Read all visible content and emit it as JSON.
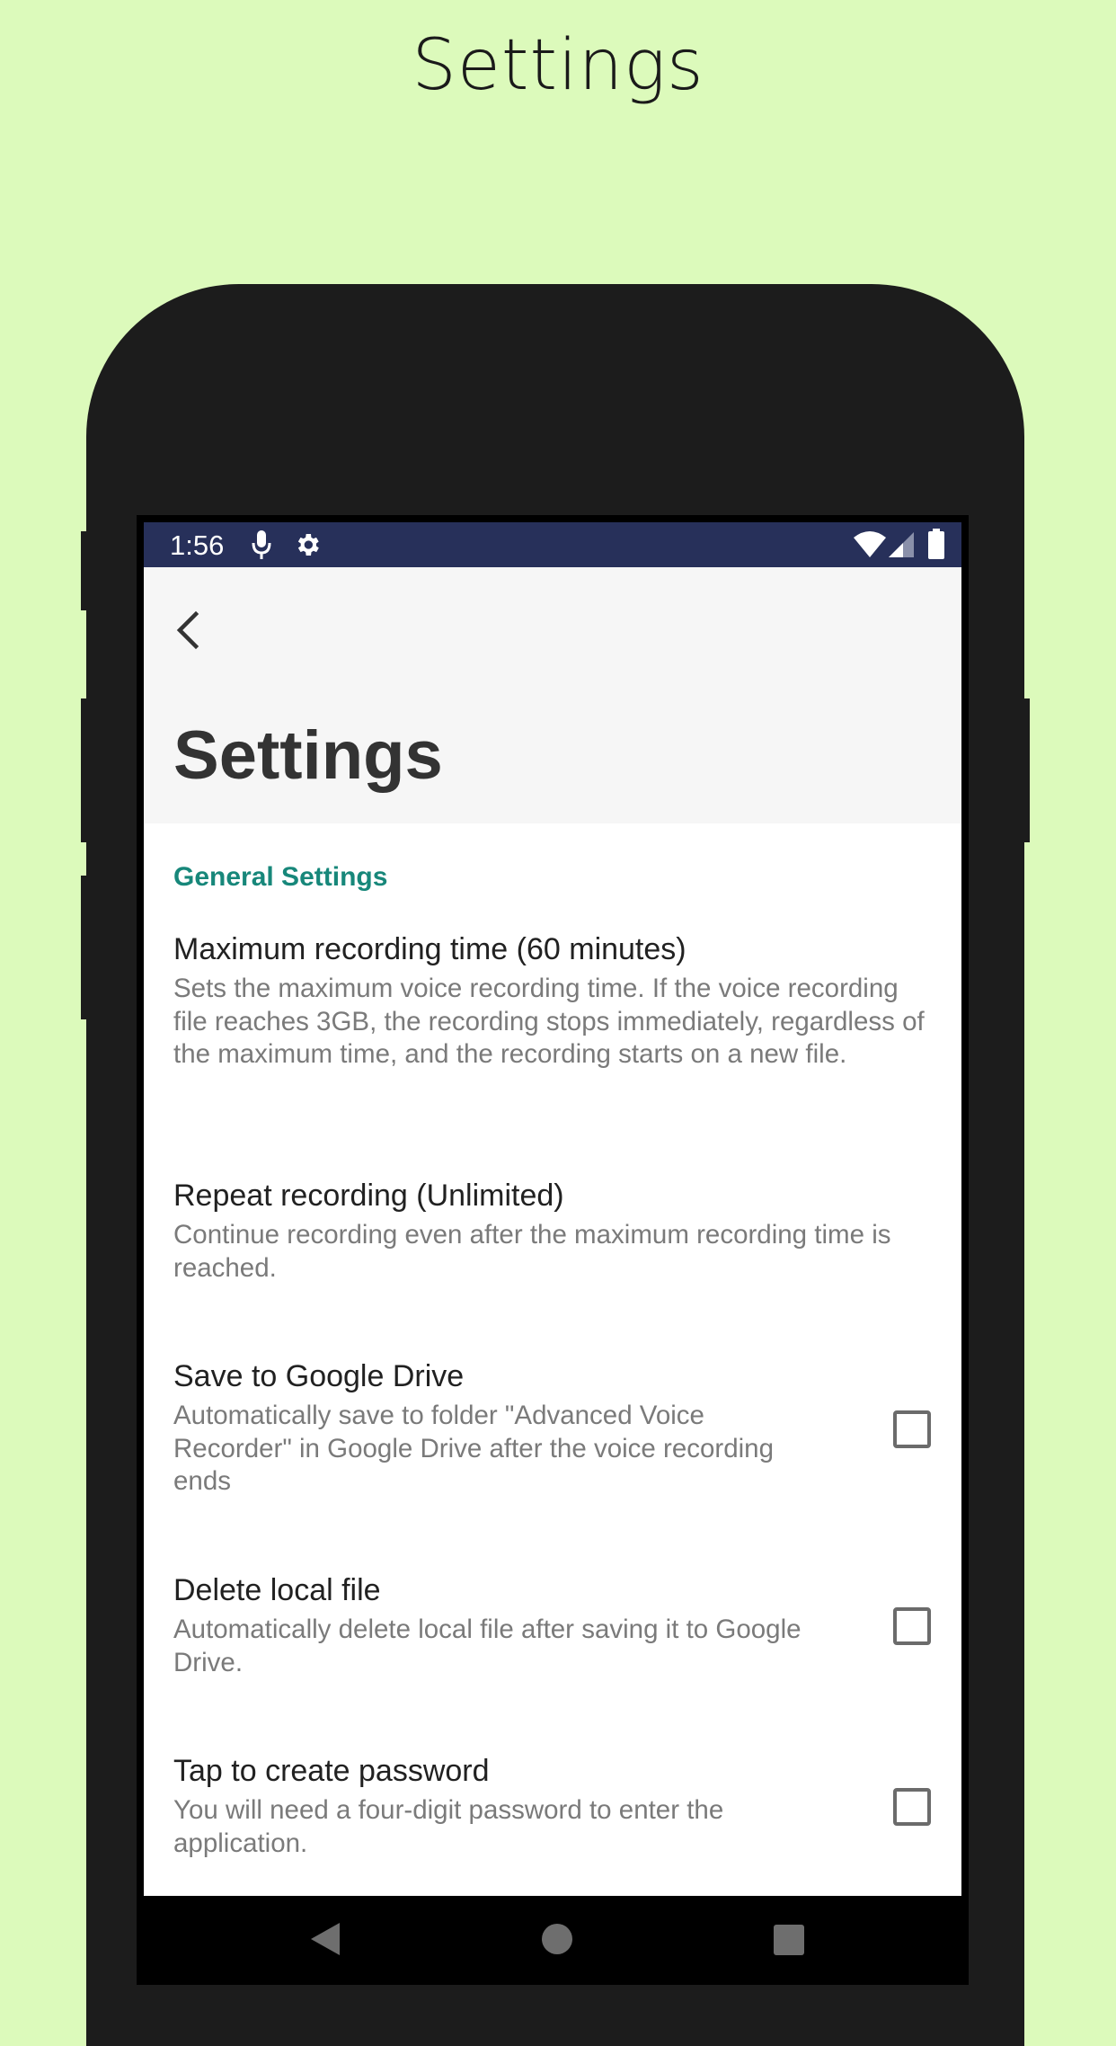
{
  "page": {
    "heading": "Settings"
  },
  "status_bar": {
    "time": "1:56",
    "icons": [
      "mic-icon",
      "gear-icon",
      "wifi-icon",
      "signal-icon",
      "battery-icon"
    ]
  },
  "app_bar": {
    "back_icon": "back-arrow-icon",
    "title": "Settings"
  },
  "settings": {
    "section_title": "General Settings",
    "items": [
      {
        "title": "Maximum recording time (60 minutes)",
        "summary": "Sets the maximum voice recording time. If the voice recording file reaches 3GB, the recording stops immediately, regardless of the maximum time, and the recording starts on a new file."
      },
      {
        "title": "Repeat recording (Unlimited)",
        "summary": "Continue recording even after the maximum recording time is reached."
      },
      {
        "title": "Save to Google Drive",
        "summary": "Automatically save to folder \"Advanced Voice Recorder\" in Google Drive after the voice recording ends",
        "checked": false
      },
      {
        "title": "Delete local file",
        "summary": "Automatically delete local file after saving it to Google Drive.",
        "checked": false
      },
      {
        "title": "Tap to create password",
        "summary": "You will need a four-digit password to enter the application.",
        "checked": false
      }
    ]
  },
  "nav_bar": {
    "icons": [
      "nav-back-icon",
      "nav-home-icon",
      "nav-recents-icon"
    ]
  },
  "colors": {
    "background": "#dcfabb",
    "status_bar": "#27305a",
    "accent": "#17877a",
    "phone_body": "#1c1c1c"
  }
}
